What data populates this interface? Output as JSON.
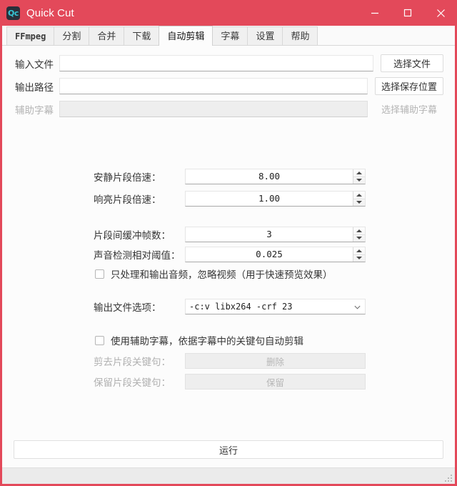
{
  "window": {
    "app_icon_text": "Qc",
    "title": "Quick Cut",
    "accent_color": "#e3495a",
    "controls": {
      "minimize": "minimize-icon",
      "maximize": "maximize-icon",
      "close": "close-icon"
    }
  },
  "tabs": [
    {
      "label": "FFmpeg",
      "active": false
    },
    {
      "label": "分割",
      "active": false
    },
    {
      "label": "合并",
      "active": false
    },
    {
      "label": "下载",
      "active": false
    },
    {
      "label": "自动剪辑",
      "active": true
    },
    {
      "label": "字幕",
      "active": false
    },
    {
      "label": "设置",
      "active": false
    },
    {
      "label": "帮助",
      "active": false
    }
  ],
  "file_rows": [
    {
      "label": "输入文件",
      "value": "",
      "placeholder": "",
      "button": "选择文件",
      "disabled": false
    },
    {
      "label": "输出路径",
      "value": "",
      "placeholder": "",
      "button": "选择保存位置",
      "disabled": false
    },
    {
      "label": "辅助字幕",
      "value": "",
      "placeholder": "",
      "button": "选择辅助字幕",
      "disabled": true
    }
  ],
  "speed_settings": [
    {
      "label": "安静片段倍速：",
      "value": "8.00"
    },
    {
      "label": "响亮片段倍速：",
      "value": "1.00"
    }
  ],
  "detection_settings": [
    {
      "label": "片段间缓冲帧数：",
      "value": "3"
    },
    {
      "label": "声音检测相对阈值：",
      "value": "0.025"
    }
  ],
  "audio_only": {
    "label": "只处理和输出音频，忽略视频（用于快速预览效果）",
    "checked": false
  },
  "output_options": {
    "label": "输出文件选项：",
    "value": "-c:v libx264 -crf 23"
  },
  "subtitle_cut": {
    "checkbox_label": "使用辅助字幕，依据字幕中的关键句自动剪辑",
    "checked": false,
    "rows": [
      {
        "label": "剪去片段关键句：",
        "value": "",
        "placeholder": "删除",
        "disabled": true
      },
      {
        "label": "保留片段关键句：",
        "value": "",
        "placeholder": "保留",
        "disabled": true
      }
    ]
  },
  "run_button": {
    "label": "运行"
  },
  "statusbar": {
    "text": ""
  }
}
